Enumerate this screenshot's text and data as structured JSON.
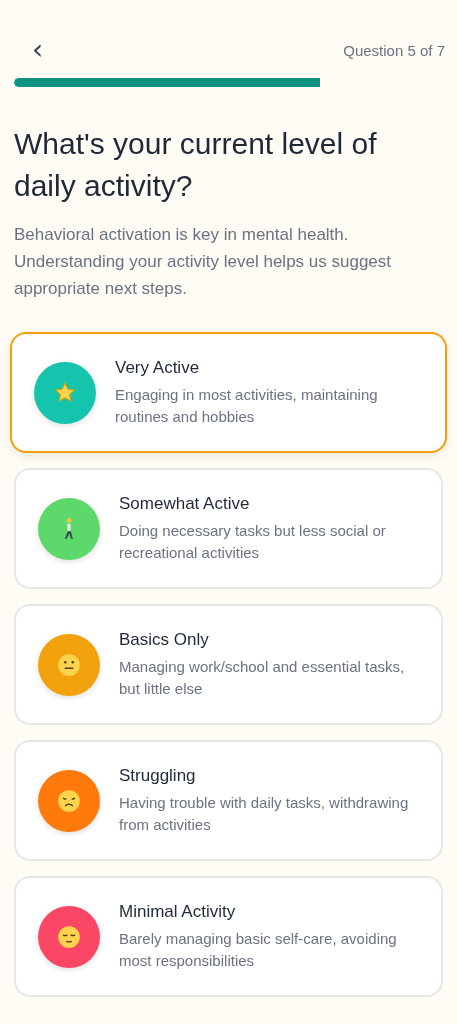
{
  "header": {
    "back": "‹",
    "step": "Question 5 of 7"
  },
  "progress": {
    "level": 0.714
  },
  "title": "What's your current level of daily activity?",
  "description": "Behavioral activation is key in mental health. Understanding your activity level helps us suggest appropriate next steps.",
  "options": [
    {
      "title": "Very Active",
      "description": "Engaging in most activities, maintaining routines and hobbies",
      "selected": true,
      "color": "#14c4ac",
      "kind": "star"
    },
    {
      "title": "Somewhat Active",
      "description": "Doing necessary tasks but less social or recreational activities",
      "selected": false,
      "color": "#5dd86a",
      "kind": "walker"
    },
    {
      "title": "Basics Only",
      "description": "Managing work/school and essential tasks, but little else",
      "selected": false,
      "color": "#f2a20c",
      "kind": "neutral"
    },
    {
      "title": "Struggling",
      "description": "Having trouble with daily tasks, withdrawing from activities",
      "selected": false,
      "color": "#ff7a0a",
      "kind": "frown"
    },
    {
      "title": "Minimal Activity",
      "description": "Barely managing basic self-care, avoiding most responsibilities",
      "selected": false,
      "color": "#fb4766",
      "kind": "sad"
    }
  ]
}
